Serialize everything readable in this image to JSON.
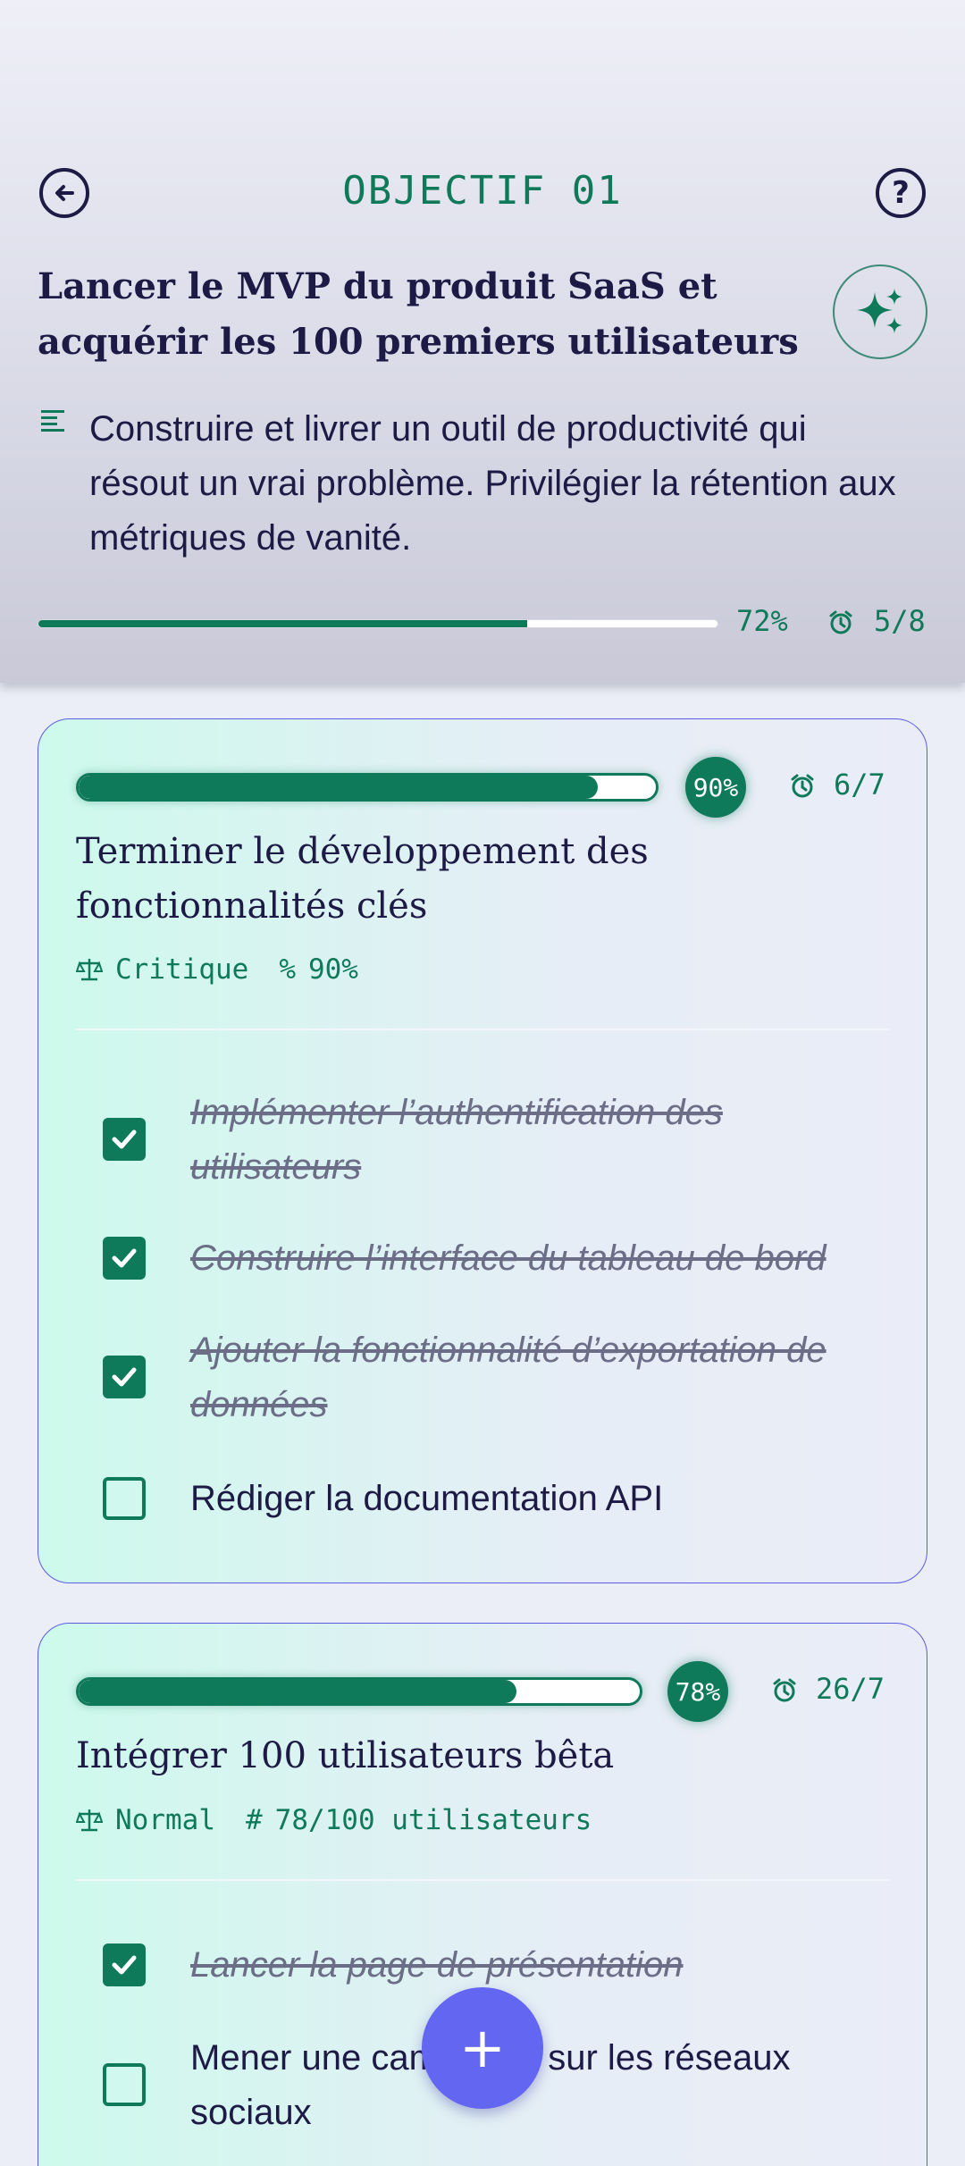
{
  "header": {
    "title": "OBJECTIF 01",
    "goal_title": "Lancer le MVP du produit SaaS et acquérir les 100 premiers utilisateurs",
    "description": "Construire et livrer un outil de productivité qui résout un vrai problème. Privilégier la rétention aux métriques de vanité.",
    "progress": 72,
    "progress_label": "72%",
    "count_label": "5/8",
    "icons": [
      "back-arrow-icon",
      "help-icon",
      "sparkle-icon",
      "description-icon",
      "alarm-icon"
    ]
  },
  "key_results": [
    {
      "progress": 90,
      "badge": "90%",
      "count": "6/7",
      "title": "Terminer le développement des fonctionnalités clés",
      "priority": "Critique",
      "metric_symbol": "%",
      "metric": "90%",
      "tasks": [
        {
          "label": "Implémenter l’authentification des utilisateurs",
          "done": true
        },
        {
          "label": "Construire l’interface du tableau de bord",
          "done": true
        },
        {
          "label": "Ajouter la fonctionnalité d’exportation de données",
          "done": true
        },
        {
          "label": "Rédiger la documentation API",
          "done": false
        }
      ]
    },
    {
      "progress": 78,
      "badge": "78%",
      "count": "26/7",
      "title": "Intégrer 100 utilisateurs bêta",
      "priority": "Normal",
      "metric_symbol": "#",
      "metric": "78/100 utilisateurs",
      "tasks": [
        {
          "label": "Lancer la page de présentation",
          "done": true
        },
        {
          "label": "Mener une campagne sur les réseaux sociaux",
          "done": false
        }
      ]
    }
  ],
  "fab": {
    "label": "+"
  },
  "colors": {
    "accent": "#0f7a5a",
    "ink": "#1d1b45",
    "fab": "#6366f1",
    "card_border": "#5c5ce0"
  }
}
